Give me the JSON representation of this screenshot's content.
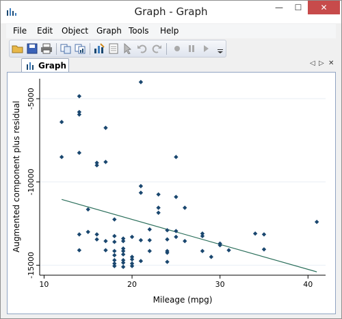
{
  "window": {
    "title": "Graph - Graph",
    "close_glyph": "✕",
    "minimize_glyph": "—",
    "maximize_glyph": "☐"
  },
  "menu": {
    "items": [
      "File",
      "Edit",
      "Object",
      "Graph",
      "Tools",
      "Help"
    ]
  },
  "toolbar": {
    "icons": [
      "open-folder-icon",
      "save-icon",
      "print-icon",
      "copy-icon",
      "copy-graph-icon",
      "graph-editor-icon",
      "data-icon",
      "pointer-icon",
      "undo-icon",
      "redo-icon",
      "record-icon",
      "pause-icon",
      "play-icon",
      "more-icon"
    ]
  },
  "tabs": [
    {
      "label": "Graph",
      "active": true
    }
  ],
  "tab_nav": {
    "prev": "◁",
    "next": "▷",
    "close": "✕"
  },
  "chart_data": {
    "type": "scatter",
    "xlabel": "Mileage (mpg)",
    "ylabel": "Augmented component plus residual",
    "xlim": [
      9.5,
      42
    ],
    "ylim": [
      -15600,
      -3800
    ],
    "xticks": [
      10,
      20,
      30,
      40
    ],
    "yticks": [
      -5000,
      -10000,
      -15000
    ],
    "xticklabels": [
      "10",
      "20",
      "30",
      "40"
    ],
    "yticklabels": [
      "-5000",
      "-10000",
      "-15000"
    ],
    "grid": true,
    "colors": {
      "marker": "#1a476f",
      "line": "#2a6e5a",
      "grid": "#e8eef4"
    },
    "points": [
      [
        21,
        -4000
      ],
      [
        14,
        -4850
      ],
      [
        14,
        -5800
      ],
      [
        14,
        -5950
      ],
      [
        12,
        -6400
      ],
      [
        17,
        -6750
      ],
      [
        14,
        -8250
      ],
      [
        12,
        -8500
      ],
      [
        25,
        -8500
      ],
      [
        16,
        -8850
      ],
      [
        16,
        -9000
      ],
      [
        17,
        -8800
      ],
      [
        21,
        -10250
      ],
      [
        21,
        -10650
      ],
      [
        23,
        -10750
      ],
      [
        25,
        -10900
      ],
      [
        23,
        -11550
      ],
      [
        23,
        -11850
      ],
      [
        26,
        -11550
      ],
      [
        15,
        -11650
      ],
      [
        18,
        -12250
      ],
      [
        41,
        -12400
      ],
      [
        22,
        -12850
      ],
      [
        24,
        -12900
      ],
      [
        25,
        -12950
      ],
      [
        14,
        -13150
      ],
      [
        15,
        -13000
      ],
      [
        16,
        -13150
      ],
      [
        18,
        -13250
      ],
      [
        20,
        -13300
      ],
      [
        19,
        -13400
      ],
      [
        16,
        -13450
      ],
      [
        24,
        -13450
      ],
      [
        25,
        -13300
      ],
      [
        28,
        -13100
      ],
      [
        28,
        -13250
      ],
      [
        34,
        -13100
      ],
      [
        35,
        -13150
      ],
      [
        17,
        -13550
      ],
      [
        18,
        -13600
      ],
      [
        19,
        -13550
      ],
      [
        21,
        -13500
      ],
      [
        22,
        -13500
      ],
      [
        26,
        -13550
      ],
      [
        30,
        -13700
      ],
      [
        30,
        -13800
      ],
      [
        14,
        -14100
      ],
      [
        17,
        -14100
      ],
      [
        18,
        -14150
      ],
      [
        19,
        -14000
      ],
      [
        19,
        -14150
      ],
      [
        22,
        -14150
      ],
      [
        24,
        -14150
      ],
      [
        24,
        -14250
      ],
      [
        28,
        -14150
      ],
      [
        31,
        -14100
      ],
      [
        35,
        -14050
      ],
      [
        18,
        -14400
      ],
      [
        19,
        -14350
      ],
      [
        20,
        -14500
      ],
      [
        29,
        -14500
      ],
      [
        18,
        -14700
      ],
      [
        19,
        -14700
      ],
      [
        20,
        -14650
      ],
      [
        21,
        -14750
      ],
      [
        18,
        -14900
      ],
      [
        19,
        -14850
      ],
      [
        20,
        -14900
      ],
      [
        24,
        -14800
      ],
      [
        18,
        -15050
      ],
      [
        19,
        -15100
      ],
      [
        20,
        -15050
      ]
    ],
    "fit_line": [
      [
        12,
        -11050
      ],
      [
        41,
        -15400
      ]
    ]
  }
}
